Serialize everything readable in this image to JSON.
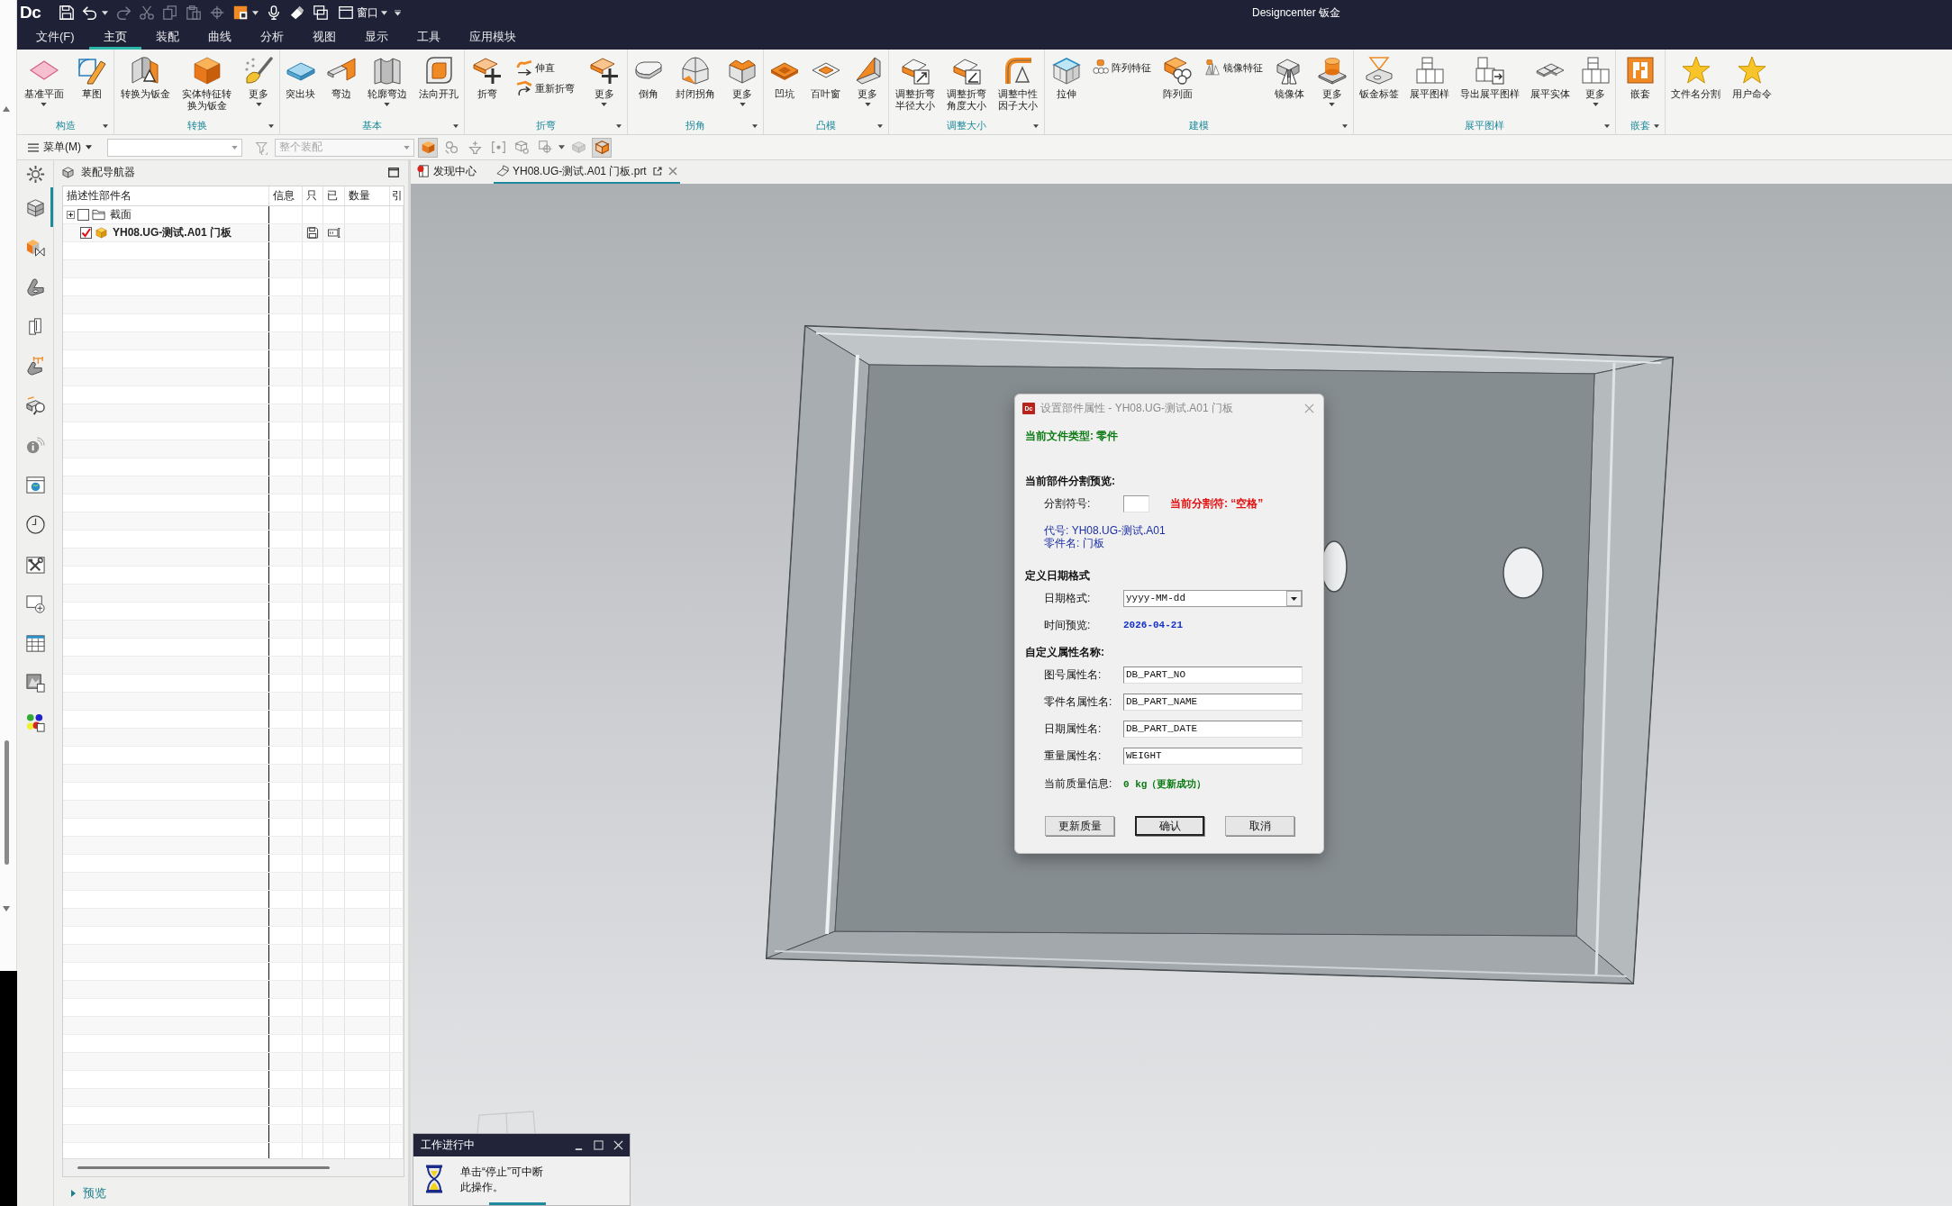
{
  "window": {
    "logo": "Dc",
    "title": "Designcenter 钣金"
  },
  "quick_access": [
    {
      "disabled": false,
      "dropdown": false
    },
    {
      "disabled": false,
      "dropdown": true
    },
    {
      "disabled": true,
      "dropdown": false
    },
    {
      "disabled": true,
      "dropdown": false
    },
    {
      "disabled": true,
      "dropdown": false
    },
    {
      "disabled": true,
      "dropdown": false
    },
    {
      "disabled": true,
      "dropdown": false
    },
    {
      "disabled": false,
      "dropdown": true
    },
    {
      "disabled": false,
      "dropdown": false
    },
    {
      "disabled": false,
      "dropdown": false
    },
    {
      "disabled": false,
      "dropdown": false
    }
  ],
  "window_menu": {
    "label": "窗口"
  },
  "menu_tabs": [
    {
      "label": "文件(F)",
      "selected": false
    },
    {
      "label": "主页",
      "selected": true
    },
    {
      "label": "装配",
      "selected": false
    },
    {
      "label": "曲线",
      "selected": false
    },
    {
      "label": "分析",
      "selected": false
    },
    {
      "label": "视图",
      "selected": false
    },
    {
      "label": "显示",
      "selected": false
    },
    {
      "label": "工具",
      "selected": false
    },
    {
      "label": "应用模块",
      "selected": false
    }
  ],
  "ribbon": {
    "groups": [
      {
        "label": "构造",
        "items": [
          {
            "kind": "large",
            "label": "基准平面",
            "dropdown": true
          },
          {
            "kind": "large",
            "label": "草图",
            "dropdown": false
          }
        ]
      },
      {
        "label": "转换",
        "items": [
          {
            "kind": "large",
            "label": "转换为钣金",
            "dropdown": false
          },
          {
            "kind": "large",
            "label": "实体特征转换为钣金",
            "dropdown": false
          },
          {
            "kind": "large",
            "label": "更多",
            "dropdown": true
          }
        ]
      },
      {
        "label": "基本",
        "items": [
          {
            "kind": "large",
            "label": "突出块",
            "dropdown": false
          },
          {
            "kind": "large",
            "label": "弯边",
            "dropdown": false
          },
          {
            "kind": "large",
            "label": "轮廓弯边",
            "dropdown": true
          },
          {
            "kind": "large",
            "label": "法向开孔",
            "dropdown": false
          }
        ]
      },
      {
        "label": "折弯",
        "items": [
          {
            "kind": "large",
            "label": "折弯",
            "dropdown": false
          },
          {
            "kind": "stack",
            "buttons": [
              {
                "label": "伸直"
              },
              {
                "label": "重新折弯"
              }
            ]
          },
          {
            "kind": "large",
            "label": "更多",
            "dropdown": true
          }
        ]
      },
      {
        "label": "拐角",
        "items": [
          {
            "kind": "large",
            "label": "倒角",
            "dropdown": false
          },
          {
            "kind": "large",
            "label": "封闭拐角",
            "dropdown": false
          },
          {
            "kind": "large",
            "label": "更多",
            "dropdown": true
          }
        ]
      },
      {
        "label": "凸模",
        "items": [
          {
            "kind": "large",
            "label": "凹坑",
            "dropdown": false
          },
          {
            "kind": "large",
            "label": "百叶窗",
            "dropdown": false
          },
          {
            "kind": "large",
            "label": "更多",
            "dropdown": true
          }
        ]
      },
      {
        "label": "调整大小",
        "items": [
          {
            "kind": "large",
            "label": "调整折弯半径大小",
            "dropdown": false
          },
          {
            "kind": "large",
            "label": "调整折弯角度大小",
            "dropdown": false
          },
          {
            "kind": "large",
            "label": "调整中性因子大小",
            "dropdown": false
          }
        ]
      },
      {
        "label": "建模",
        "items": [
          {
            "kind": "large",
            "label": "拉伸",
            "dropdown": false
          },
          {
            "kind": "stack",
            "buttons": [
              {
                "label": "阵列特征"
              }
            ]
          },
          {
            "kind": "large",
            "label": "阵列面",
            "dropdown": false
          },
          {
            "kind": "stack",
            "buttons": [
              {
                "label": "镜像特征"
              }
            ]
          },
          {
            "kind": "large",
            "label": "镜像体",
            "dropdown": false
          },
          {
            "kind": "large",
            "label": "更多",
            "dropdown": true
          }
        ]
      },
      {
        "label": "展平图样",
        "items": [
          {
            "kind": "large",
            "label": "钣金标签",
            "dropdown": false
          },
          {
            "kind": "large",
            "label": "展平图样",
            "dropdown": false
          },
          {
            "kind": "large",
            "label": "导出展平图样",
            "dropdown": false
          },
          {
            "kind": "large",
            "label": "展平实体",
            "dropdown": false
          },
          {
            "kind": "large",
            "label": "更多",
            "dropdown": true
          }
        ]
      },
      {
        "label": "嵌套",
        "items": [
          {
            "kind": "large",
            "label": "嵌套",
            "dropdown": false
          }
        ]
      },
      {
        "items": [
          {
            "kind": "large",
            "label": "文件名分割",
            "dropdown": false
          },
          {
            "kind": "large",
            "label": "用户命令",
            "dropdown": false
          }
        ]
      }
    ]
  },
  "selection_bar": {
    "menu": "菜单(M)",
    "scope": {
      "value": "整个装配",
      "disabled": true
    },
    "tools": [
      {
        "selected": true,
        "dropdown": false
      },
      {
        "selected": false,
        "dropdown": false
      },
      {
        "selected": false,
        "dropdown": false
      },
      {
        "selected": false,
        "dropdown": false
      },
      {
        "selected": false,
        "dropdown": false
      },
      {
        "selected": false,
        "dropdown": true
      },
      {
        "selected": false,
        "dropdown": false
      },
      {
        "selected": true,
        "dropdown": false
      }
    ]
  },
  "resource_bar": [
    {
      "selected": false
    },
    {
      "selected": true
    },
    {
      "selected": false
    },
    {
      "selected": false
    },
    {
      "selected": false
    },
    {
      "selected": false
    },
    {
      "selected": false
    },
    {
      "selected": false
    },
    {
      "selected": false
    },
    {
      "selected": false
    },
    {
      "selected": false
    },
    {
      "selected": false
    },
    {
      "selected": false
    },
    {
      "selected": false
    },
    {
      "selected": false
    }
  ],
  "navigator": {
    "title": "装配导航器",
    "columns": [
      "描述性部件名",
      "信息",
      "只",
      "已",
      "数量",
      "引"
    ],
    "rows": [
      {
        "kind": "folder",
        "name": "截面",
        "expanded": false,
        "checked": false,
        "current": false,
        "readonly_icon": false,
        "modified_icon": false
      },
      {
        "kind": "part",
        "name": "YH08.UG-测试.A01 门板",
        "checked": true,
        "current": true,
        "readonly_icon": true,
        "modified_icon": true
      }
    ],
    "preview": {
      "label": "预览",
      "expanded": false
    }
  },
  "viewport": {
    "tabs": [
      {
        "label": "发现中心",
        "selected": false,
        "closable": false
      },
      {
        "label": "YH08.UG-测试.A01 门板.prt",
        "selected": true,
        "closable": true
      }
    ]
  },
  "dialog": {
    "logo": "Dc",
    "title": "设置部件属性 - YH08.UG-测试.A01 门板",
    "file_type": "当前文件类型: 零件",
    "split_heading": "当前部件分割预览:",
    "separator_label": "分割符号:",
    "separator_note": "当前分割符: “空格”",
    "code_line": "代号: YH08.UG-测试.A01",
    "part_name_line": "零件名: 门板",
    "date_heading": "定义日期格式",
    "date_format_label": "日期格式:",
    "date_format_value": "yyyy-MM-dd",
    "preview_label": "时间预览:",
    "preview_value": "2026-04-21",
    "attr_heading": "自定义属性名称:",
    "attr_fields": [
      {
        "label": "图号属性名:",
        "value": "DB_PART_NO"
      },
      {
        "label": "零件名属性名:",
        "value": "DB_PART_NAME"
      },
      {
        "label": "日期属性名:",
        "value": "DB_PART_DATE"
      },
      {
        "label": "重量属性名:",
        "value": "WEIGHT"
      }
    ],
    "mass_label": "当前质量信息:",
    "mass_value": "0 kg（更新成功）",
    "buttons": [
      {
        "label": "更新质量",
        "default": false
      },
      {
        "label": "确认",
        "default": true
      },
      {
        "label": "取消",
        "default": false
      }
    ]
  },
  "progress": {
    "title": "工作进行中",
    "message_lines": [
      "单击“停止”可中断",
      "此操作。"
    ]
  }
}
